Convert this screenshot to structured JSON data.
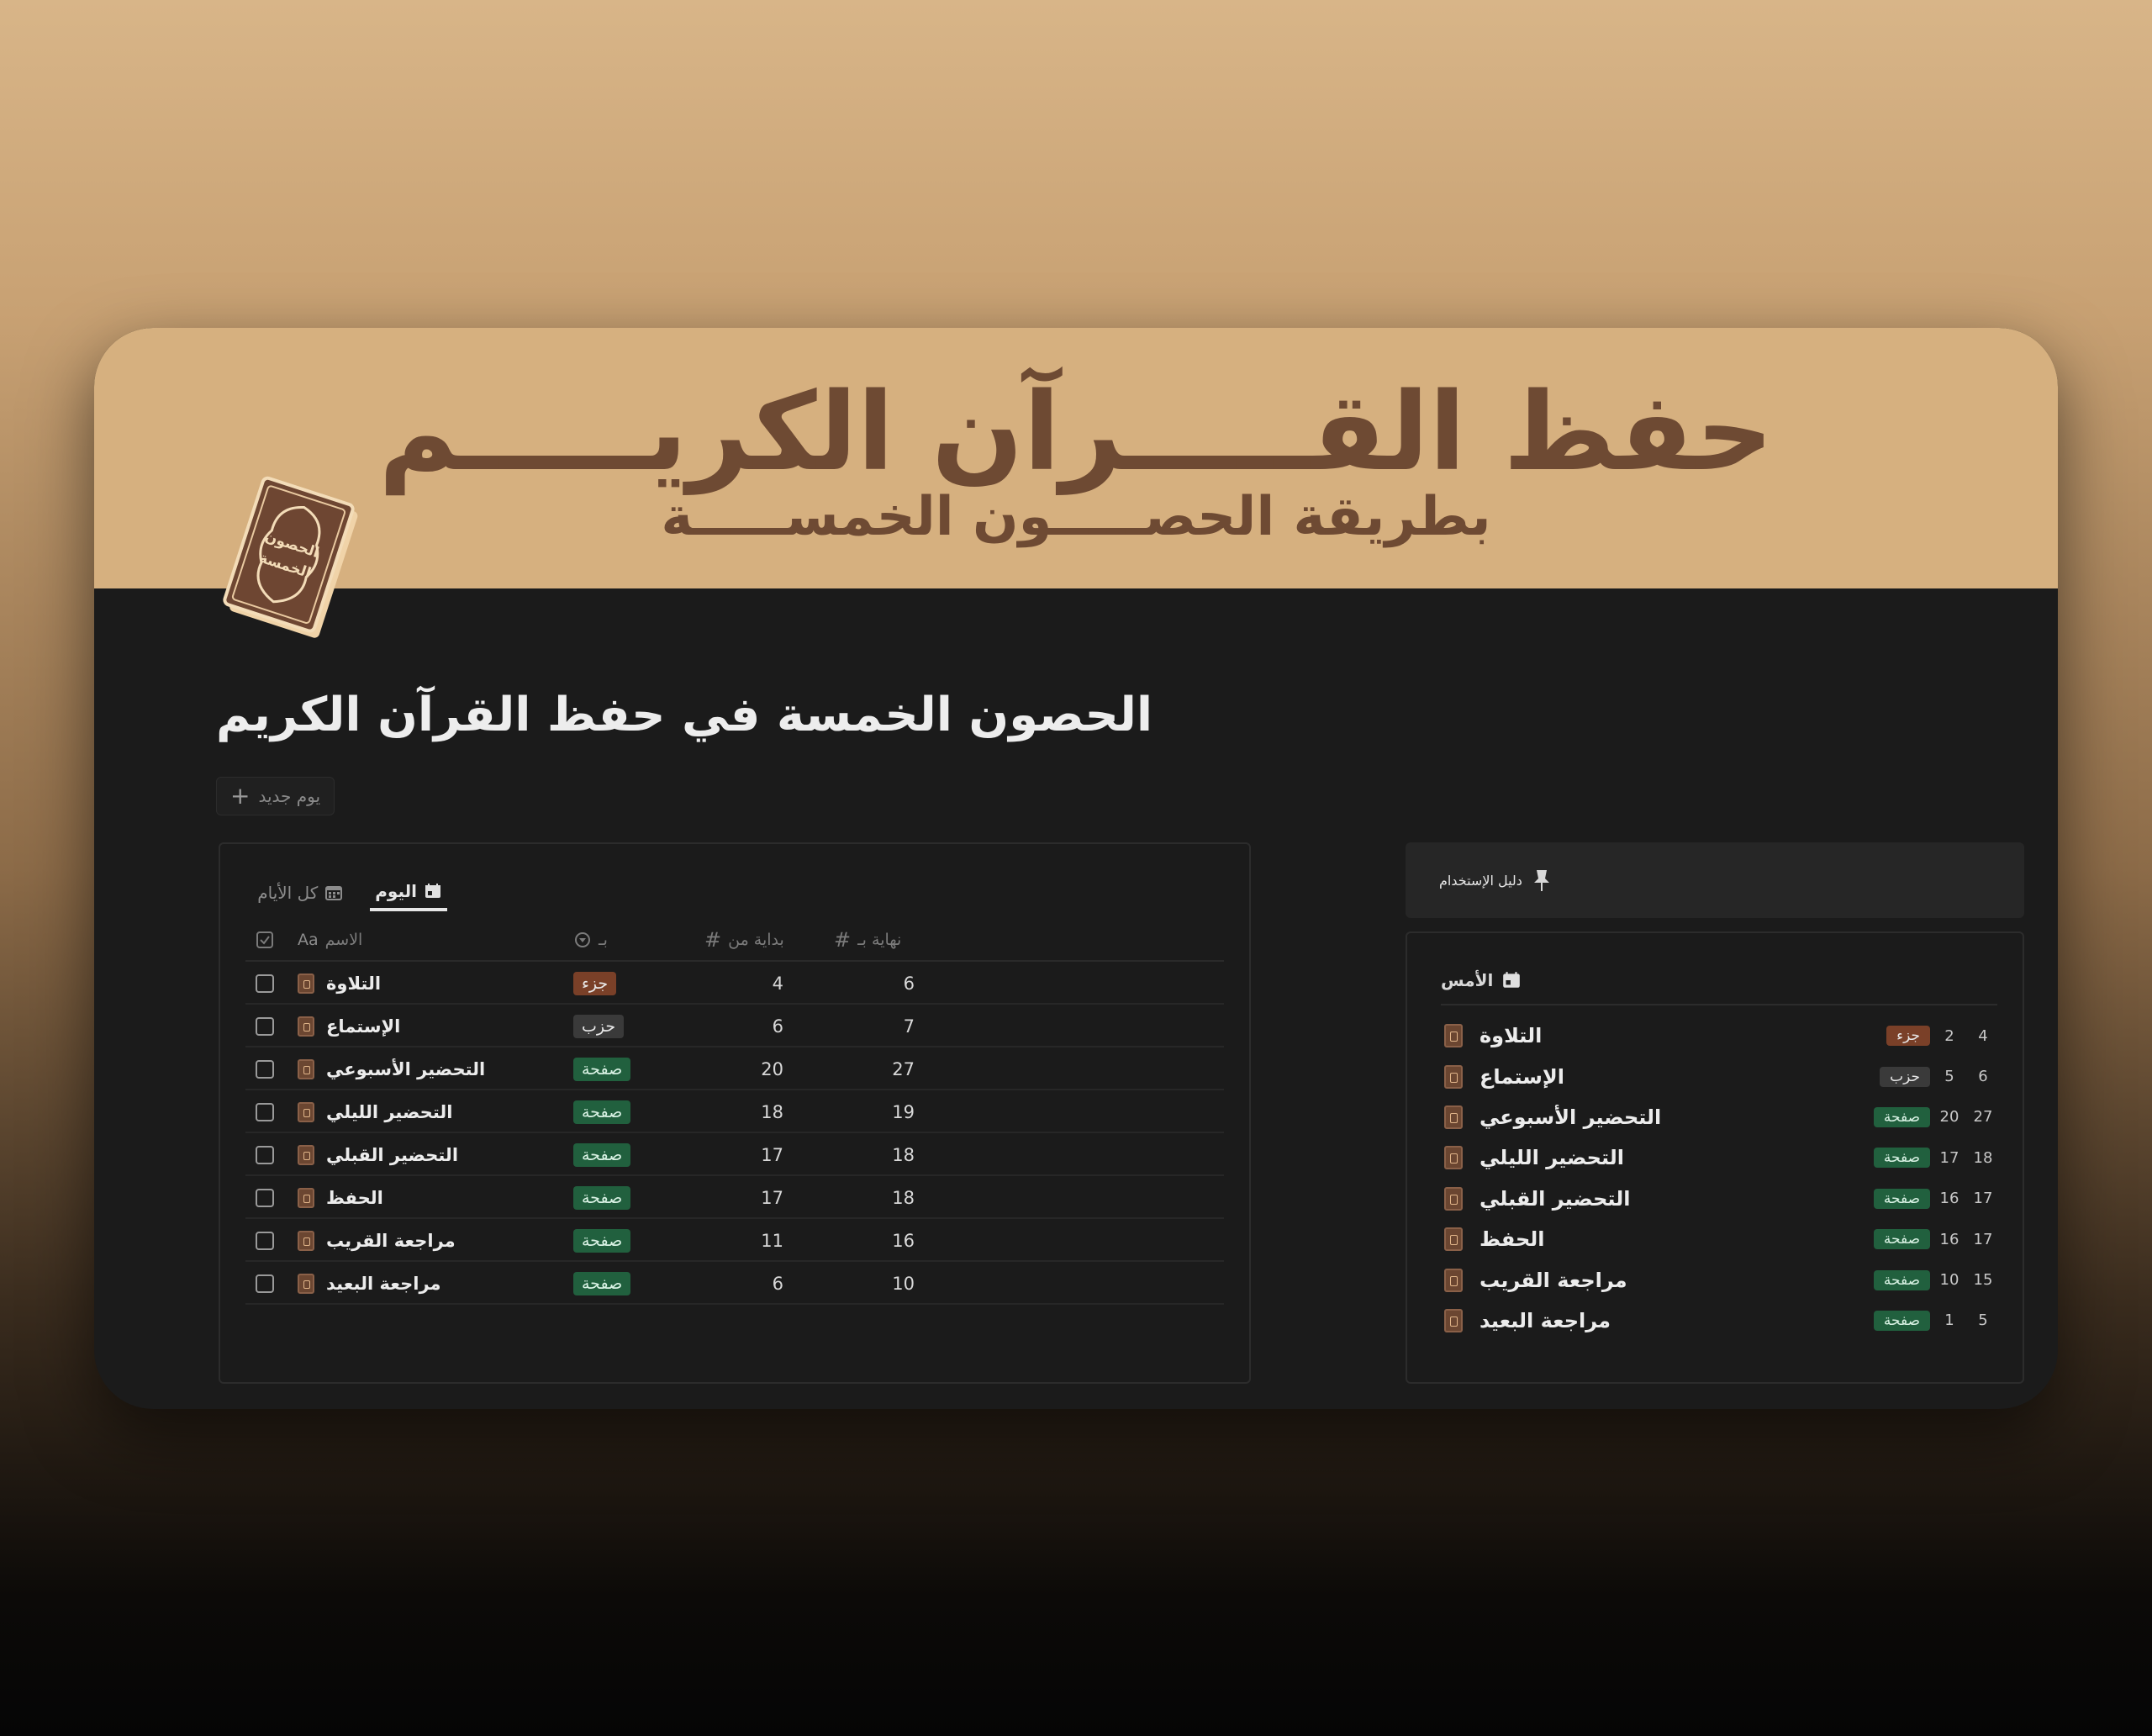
{
  "banner": {
    "title": "حفظ القـــــرآن الكريـــــم",
    "subtitle": "بطريقة الحصـــــون الخمســـــة",
    "book_label_line1": "الحصون",
    "book_label_line2": "الخمسة"
  },
  "page": {
    "title": "الحصون الخمسة في حفظ القرآن الكريم",
    "new_day_button": "يوم جديد"
  },
  "database": {
    "tabs": [
      {
        "label": "اليوم",
        "active": true,
        "icon": "calendar-icon"
      },
      {
        "label": "كل الأيام",
        "active": false,
        "icon": "calendar-grid-icon"
      }
    ],
    "columns": {
      "name": "الاسم",
      "name_prefix": "Aa",
      "unit": "بـ",
      "start": "بداية من",
      "end": "نهاية بـ"
    },
    "rows": [
      {
        "name": "التلاوة",
        "unit": "جزء",
        "unit_type": "juz",
        "start": "4",
        "end": "6"
      },
      {
        "name": "الإستماع",
        "unit": "حزب",
        "unit_type": "hizb",
        "start": "6",
        "end": "7"
      },
      {
        "name": "التحضير الأسبوعي",
        "unit": "صفحة",
        "unit_type": "page",
        "start": "20",
        "end": "27"
      },
      {
        "name": "التحضير الليلي",
        "unit": "صفحة",
        "unit_type": "page",
        "start": "18",
        "end": "19"
      },
      {
        "name": "التحضير القبلي",
        "unit": "صفحة",
        "unit_type": "page",
        "start": "17",
        "end": "18"
      },
      {
        "name": "الحفظ",
        "unit": "صفحة",
        "unit_type": "page",
        "start": "17",
        "end": "18"
      },
      {
        "name": "مراجعة القريب",
        "unit": "صفحة",
        "unit_type": "page",
        "start": "11",
        "end": "16"
      },
      {
        "name": "مراجعة البعيد",
        "unit": "صفحة",
        "unit_type": "page",
        "start": "6",
        "end": "10"
      }
    ]
  },
  "guide": {
    "label": "دليل الإستخدام"
  },
  "yesterday": {
    "title": "الأمس",
    "rows": [
      {
        "name": "التلاوة",
        "unit": "جزء",
        "unit_type": "juz",
        "start": "2",
        "end": "4"
      },
      {
        "name": "الإستماع",
        "unit": "حزب",
        "unit_type": "hizb",
        "start": "5",
        "end": "6"
      },
      {
        "name": "التحضير الأسبوعي",
        "unit": "صفحة",
        "unit_type": "page",
        "start": "20",
        "end": "27"
      },
      {
        "name": "التحضير الليلي",
        "unit": "صفحة",
        "unit_type": "page",
        "start": "17",
        "end": "18"
      },
      {
        "name": "التحضير القبلي",
        "unit": "صفحة",
        "unit_type": "page",
        "start": "16",
        "end": "17"
      },
      {
        "name": "الحفظ",
        "unit": "صفحة",
        "unit_type": "page",
        "start": "16",
        "end": "17"
      },
      {
        "name": "مراجعة القريب",
        "unit": "صفحة",
        "unit_type": "page",
        "start": "10",
        "end": "15"
      },
      {
        "name": "مراجعة البعيد",
        "unit": "صفحة",
        "unit_type": "page",
        "start": "1",
        "end": "5"
      }
    ]
  },
  "colors": {
    "banner": "#d6b07f",
    "banner_text": "#6e4a33",
    "tag_juz": "#7a4028",
    "tag_hizb": "#3a3a3a",
    "tag_page": "#21603e"
  }
}
